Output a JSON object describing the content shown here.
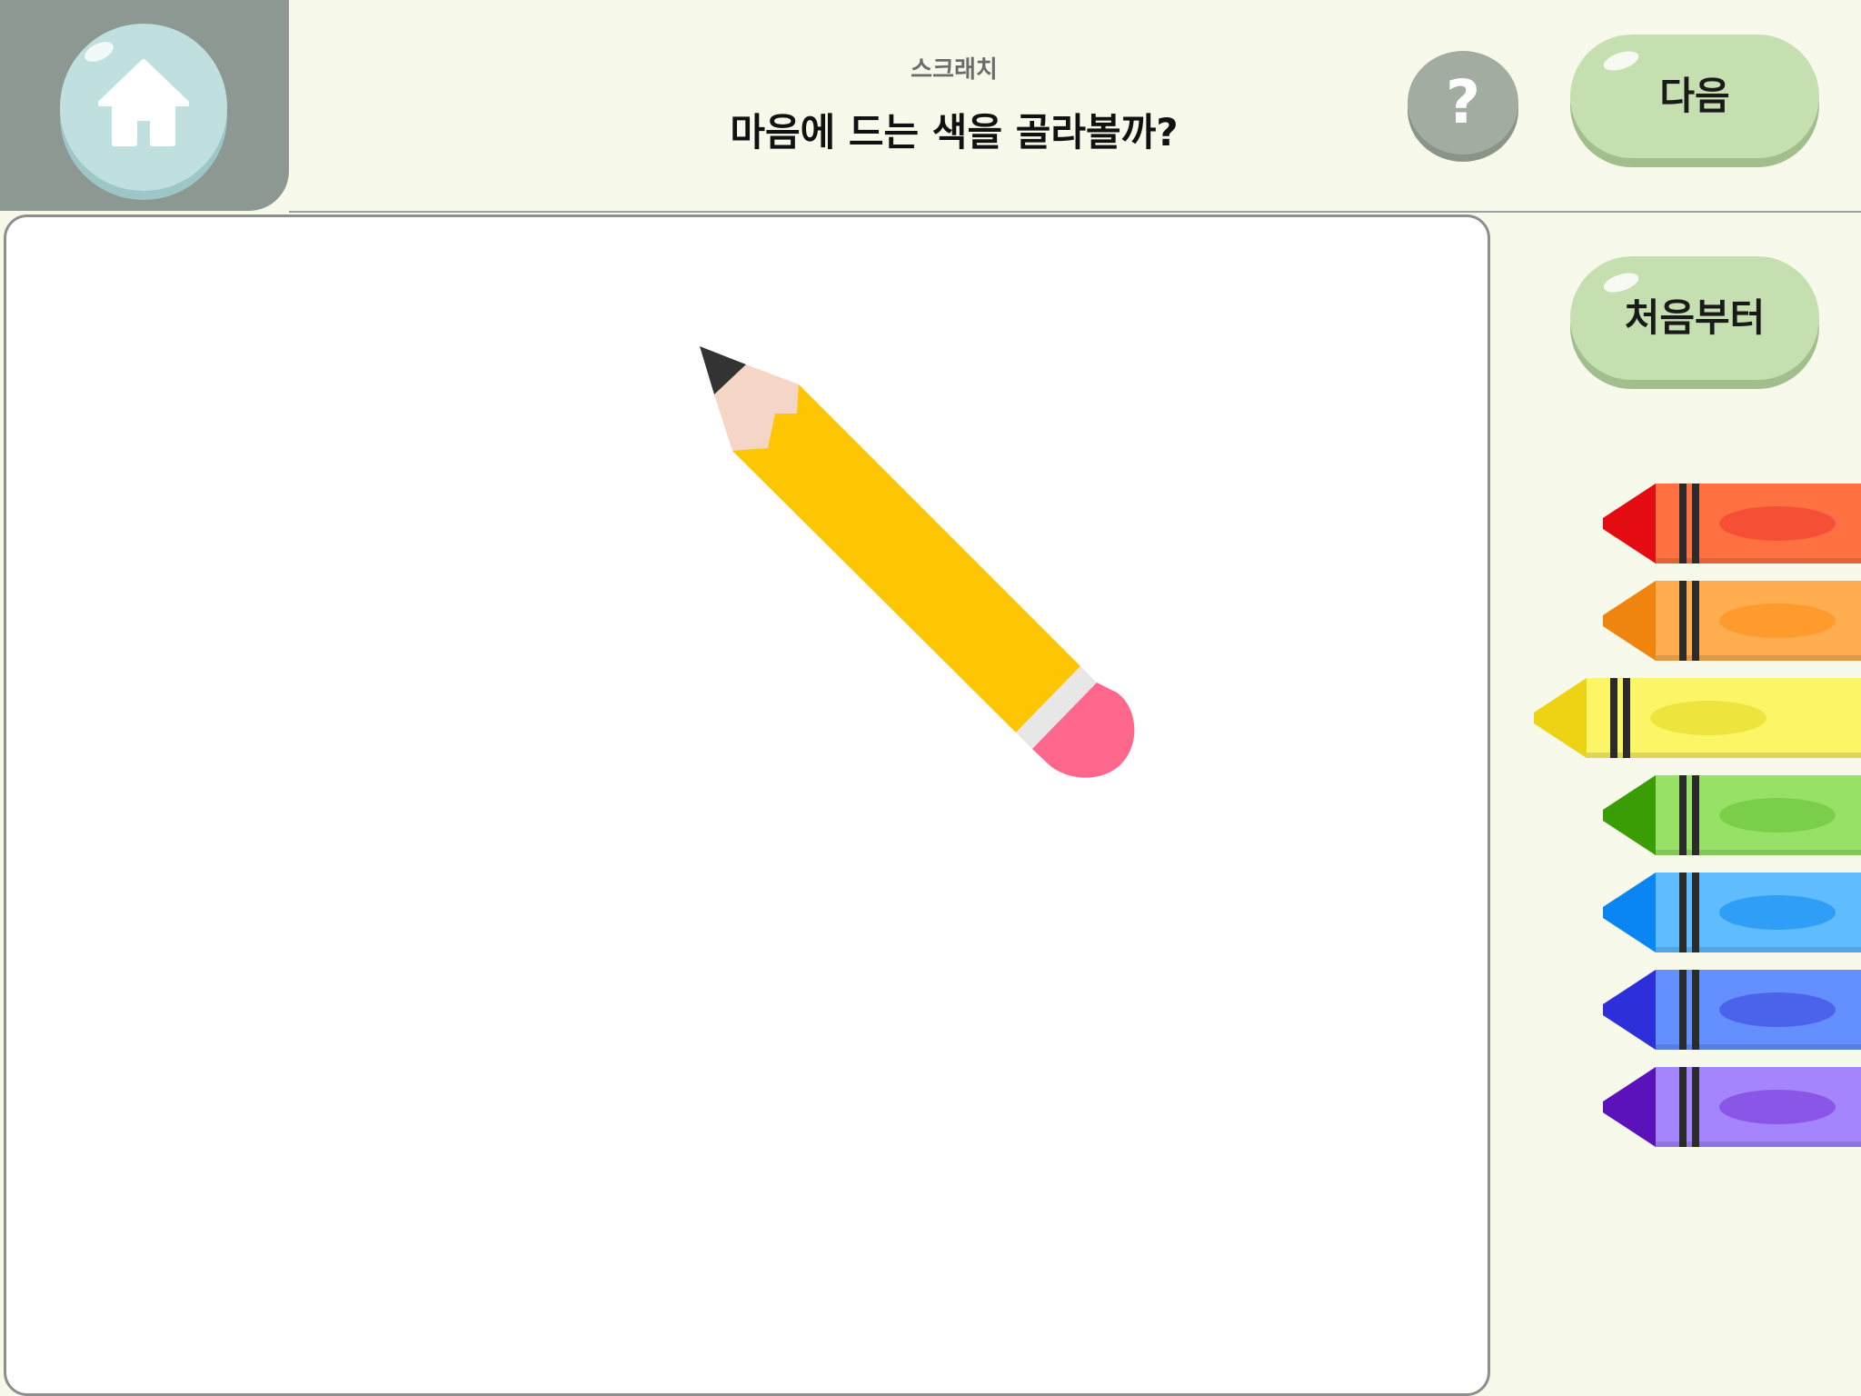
{
  "header": {
    "subtitle": "스크래치",
    "title": "마음에 드는 색을 골라볼까?",
    "help_label": "?",
    "next_label": "다음"
  },
  "home": {
    "icon": "home-icon"
  },
  "sidebar": {
    "restart_label": "처음부터"
  },
  "canvas": {
    "object": "pencil-icon"
  },
  "crayons": [
    {
      "name": "red",
      "tip": "#e40b12",
      "body": "#ff7140",
      "oval": "#f55035"
    },
    {
      "name": "orange",
      "tip": "#ef850f",
      "body": "#ffad4e",
      "oval": "#ff9b2d"
    },
    {
      "name": "yellow",
      "tip": "#eed314",
      "body": "#fcf565",
      "oval": "#ede53d",
      "selected": true
    },
    {
      "name": "green",
      "tip": "#3b9d05",
      "body": "#97e266",
      "oval": "#7ace4a"
    },
    {
      "name": "sky",
      "tip": "#0a86f4",
      "body": "#5ebcff",
      "oval": "#2f9ef6"
    },
    {
      "name": "blue",
      "tip": "#2d30da",
      "body": "#6490ff",
      "oval": "#4b63ea"
    },
    {
      "name": "purple",
      "tip": "#5c12bb",
      "body": "#a585fe",
      "oval": "#8a56e8"
    }
  ],
  "colors": {
    "header_bg": "#f7f9ea",
    "home_tab": "#8d9893",
    "button_green": "#c5dfb0",
    "pencil_body": "#fec600",
    "eraser": "#ff688c"
  }
}
